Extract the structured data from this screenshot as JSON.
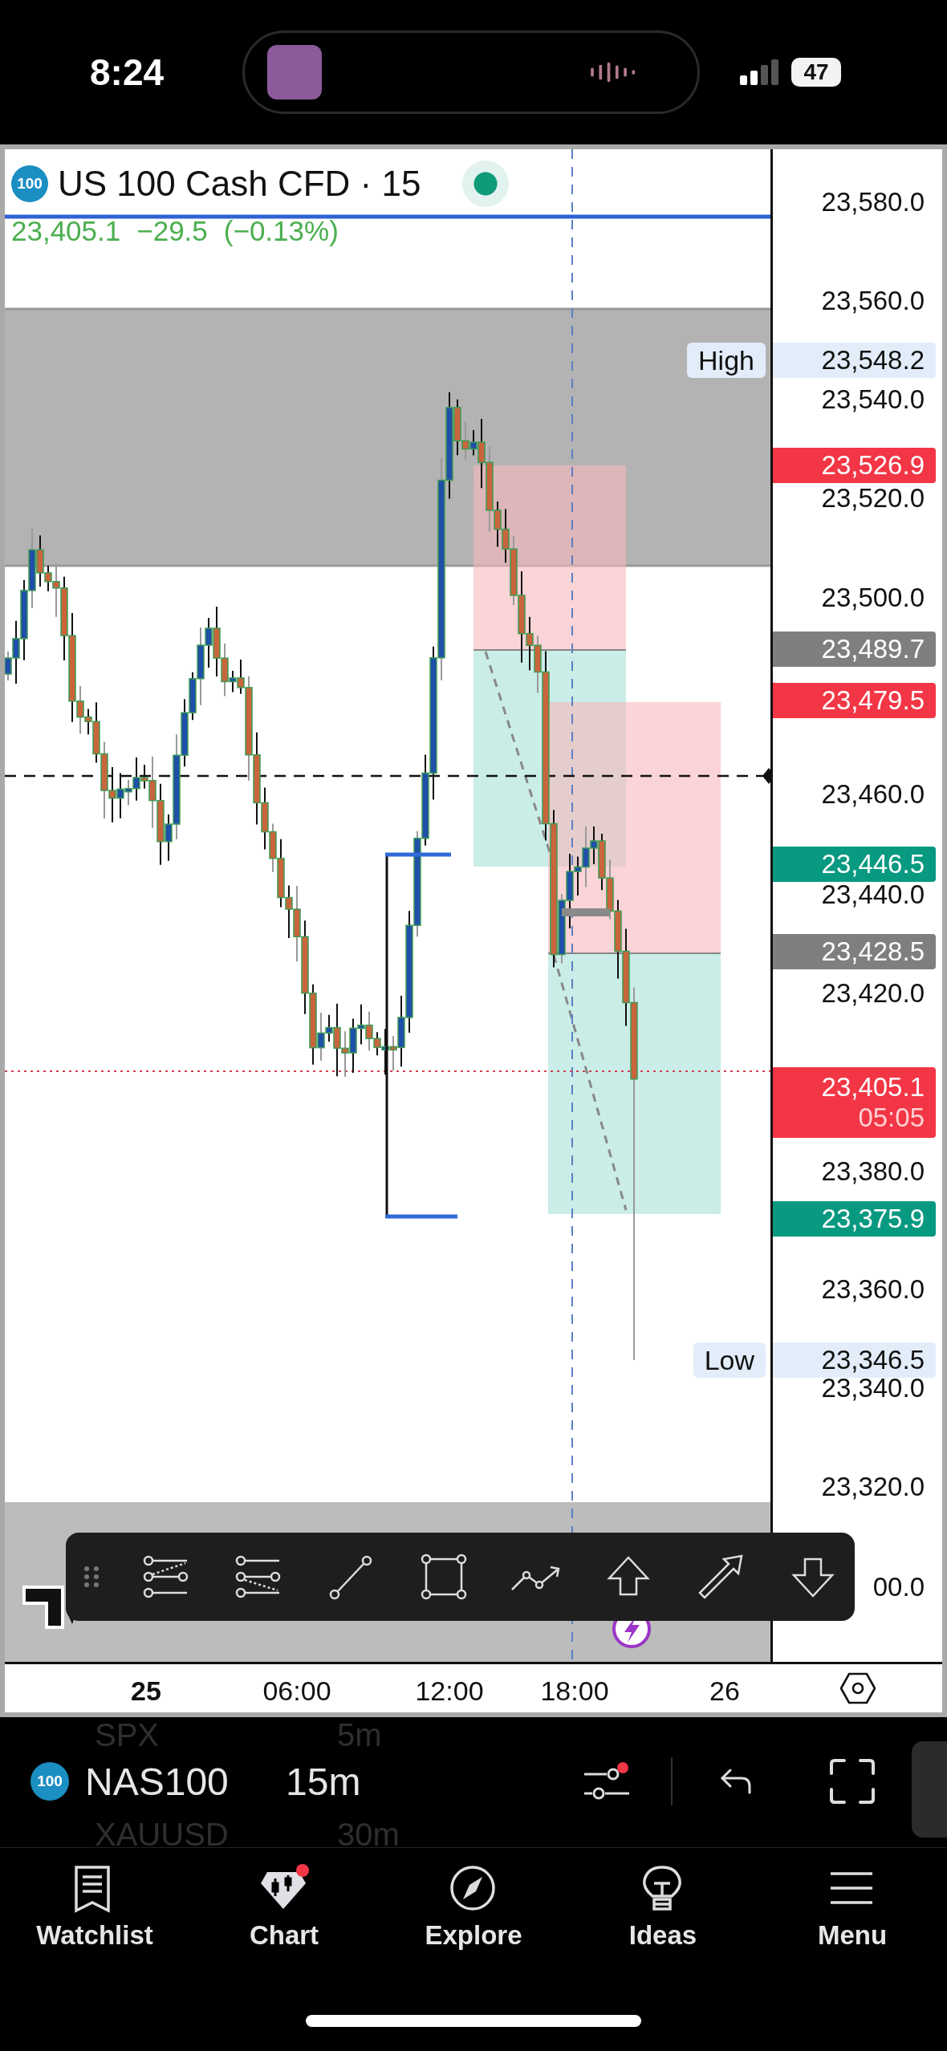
{
  "status_bar": {
    "time": "8:24",
    "battery": "47"
  },
  "chart": {
    "header": {
      "badge": "100",
      "title": "US 100 Cash CFD · 15",
      "price": "23,405.1",
      "change": "−29.5",
      "change_pct": "(−0.13%)",
      "live": true
    },
    "price_axis": [
      {
        "text": "23,580.0",
        "kind": "tick"
      },
      {
        "text": "23,560.0",
        "kind": "tick"
      },
      {
        "text": "23,548.2",
        "kind": "soft",
        "color": "#e3edf9",
        "marker": "High"
      },
      {
        "text": "23,540.0",
        "kind": "tick"
      },
      {
        "text": "23,526.9",
        "kind": "tag",
        "color": "#f23645"
      },
      {
        "text": "23,520.0",
        "kind": "tick"
      },
      {
        "text": "23,500.0",
        "kind": "tick"
      },
      {
        "text": "23,489.7",
        "kind": "tag",
        "color": "#7f7f7f"
      },
      {
        "text": "23,479.5",
        "kind": "tag",
        "color": "#f23645"
      },
      {
        "text": "23,460.0",
        "kind": "tick"
      },
      {
        "text": "23,446.5",
        "kind": "tag",
        "color": "#089981"
      },
      {
        "text": "23,440.0",
        "kind": "tick"
      },
      {
        "text": "23,428.5",
        "kind": "tag",
        "color": "#7f7f7f"
      },
      {
        "text": "23,420.0",
        "kind": "tick"
      },
      {
        "text": "23,405.1",
        "kind": "tag",
        "color": "#f23645",
        "countdown": "05:05"
      },
      {
        "text": "23,380.0",
        "kind": "tick"
      },
      {
        "text": "23,375.9",
        "kind": "tag",
        "color": "#089981"
      },
      {
        "text": "23,360.0",
        "kind": "tick"
      },
      {
        "text": "23,346.5",
        "kind": "soft",
        "color": "#e3edf9",
        "marker": "Low"
      },
      {
        "text": "23,340.0",
        "kind": "tick"
      },
      {
        "text": "23,320.0",
        "kind": "tick"
      },
      {
        "text": "00.0",
        "kind": "tick"
      }
    ],
    "time_axis": [
      {
        "text": "25",
        "kind": "day"
      },
      {
        "text": "06:00",
        "kind": "time"
      },
      {
        "text": "12:00",
        "kind": "time"
      },
      {
        "text": "18:00",
        "kind": "time"
      },
      {
        "text": "26",
        "kind": "day"
      }
    ]
  },
  "symbol_bar": {
    "badge": "100",
    "symbol": "NAS100",
    "interval": "15m",
    "previous": {
      "symbol": "SPX",
      "interval": "5m"
    },
    "next": {
      "symbol": "XAUUSD",
      "interval": "30m"
    },
    "settings_alert": true
  },
  "nav": [
    {
      "label": "Watchlist",
      "kind": "watchlist",
      "badge": false
    },
    {
      "label": "Chart",
      "kind": "chart",
      "badge": true
    },
    {
      "label": "Explore",
      "kind": "explore",
      "badge": false
    },
    {
      "label": "Ideas",
      "kind": "ideas",
      "badge": false
    },
    {
      "label": "Menu",
      "kind": "menu",
      "badge": false
    }
  ]
}
